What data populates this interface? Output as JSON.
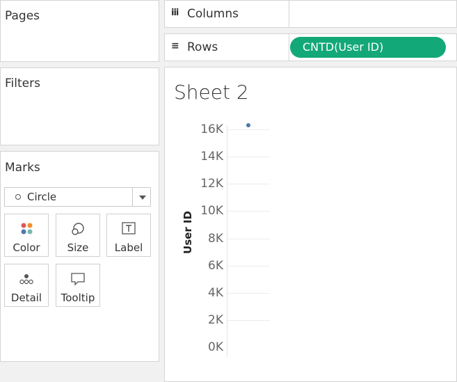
{
  "side_panel": {
    "pages_title": "Pages",
    "filters_title": "Filters",
    "marks": {
      "title": "Marks",
      "mark_type": "Circle",
      "buttons": [
        {
          "label": "Color",
          "icon": "color-dots-icon"
        },
        {
          "label": "Size",
          "icon": "size-circles-icon"
        },
        {
          "label": "Label",
          "icon": "text-label-icon"
        },
        {
          "label": "Detail",
          "icon": "detail-dots-icon"
        },
        {
          "label": "Tooltip",
          "icon": "speech-bubble-icon"
        }
      ]
    }
  },
  "shelves": {
    "columns": {
      "label": "Columns",
      "icon": "columns-icon",
      "pills": []
    },
    "rows": {
      "label": "Rows",
      "icon": "rows-icon",
      "pills": [
        "CNTD(User ID)"
      ]
    }
  },
  "colors": {
    "pill": "#13a877",
    "mark": "#4e79a7",
    "color_icon_dots": [
      "#e15759",
      "#f28e2b",
      "#4e79a7",
      "#76b7b2"
    ]
  },
  "sheet": {
    "title": "Sheet 2"
  },
  "chart_data": {
    "type": "scatter",
    "ylabel": "User ID",
    "y_ticks": [
      "0K",
      "2K",
      "4K",
      "6K",
      "8K",
      "10K",
      "12K",
      "14K",
      "16K"
    ],
    "ylim": [
      0,
      16300
    ],
    "values": [
      16300
    ],
    "grid": true
  }
}
